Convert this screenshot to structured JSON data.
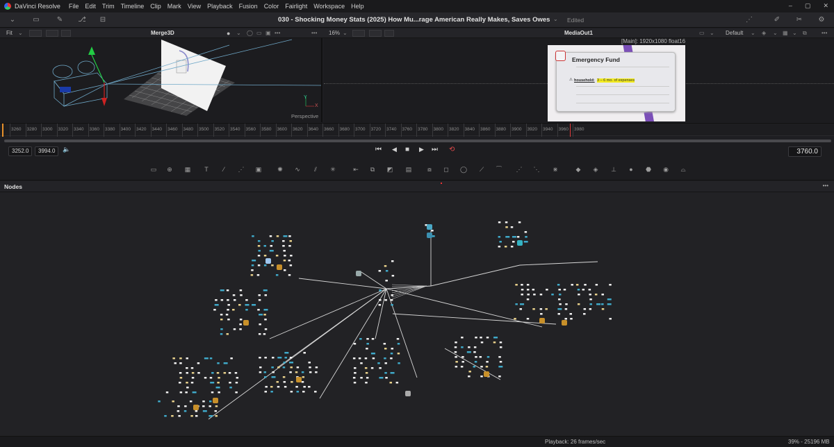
{
  "app": {
    "name": "DaVinci Resolve"
  },
  "menu": [
    "File",
    "Edit",
    "Trim",
    "Timeline",
    "Clip",
    "Mark",
    "View",
    "Playback",
    "Fusion",
    "Color",
    "Fairlight",
    "Workspace",
    "Help"
  ],
  "window_controls": [
    "–",
    "▢",
    "✕"
  ],
  "project": {
    "title": "030 - Shocking Money Stats (2025) How Mu...rage American Really Makes, Saves  Owes",
    "status": "Edited"
  },
  "viewer_left": {
    "fit_label": "Fit",
    "node_name": "Merge3D",
    "view_label": "Perspective",
    "axis_y": "Y",
    "axis_x": "X"
  },
  "viewer_right": {
    "zoom": "16%",
    "node_name": "MediaOut1",
    "view_mode": "Default",
    "resolution": "[Main]: 1920x1080 float16"
  },
  "preview": {
    "heading": "Emergency Fund",
    "line_bold": "household:",
    "line_highlight": "3 – 6 mo. of expenses"
  },
  "ruler": {
    "labels": [
      "3260",
      "3280",
      "3300",
      "3320",
      "3340",
      "3360",
      "3380",
      "3400",
      "3420",
      "3440",
      "3460",
      "3480",
      "3500",
      "3520",
      "3540",
      "3560",
      "3580",
      "3600",
      "3620",
      "3640",
      "3660",
      "3680",
      "3700",
      "3720",
      "3740",
      "3760",
      "3780",
      "3800",
      "3820",
      "3840",
      "3860",
      "3880",
      "3900",
      "3920",
      "3940",
      "3960",
      "3980"
    ]
  },
  "transport": {
    "in_point": "3252.0",
    "out_point": "3994.0",
    "current_frame": "3760.0",
    "controls": [
      "⏮",
      "◀",
      "■",
      "▶",
      "⏭",
      "⟲"
    ]
  },
  "tools": [
    "▭",
    "⊕",
    "▦",
    "T",
    "⁄",
    "⋰",
    "▣",
    "✺",
    "∿",
    "⫽",
    "✳",
    "⇤",
    "⧉",
    "◩",
    "▤",
    "⧇",
    "◻",
    "◯",
    "⟋",
    "⁀",
    "⋰",
    "⋱",
    "⋇",
    "◆",
    "◈",
    "⊥",
    "●",
    "⬣",
    "◉",
    "⌓"
  ],
  "nodes_panel": {
    "title": "Nodes",
    "menu": "•••"
  },
  "status": {
    "playback": "Playback: 26 frames/sec",
    "memory": "39% - 25196 MB"
  },
  "colors": {
    "accent_orange": "#e8912a",
    "playhead_red": "#e33b3b",
    "loop_red": "#e04a4a",
    "node_yellow": "#e8d08a",
    "node_blue": "#3fa9c9"
  }
}
